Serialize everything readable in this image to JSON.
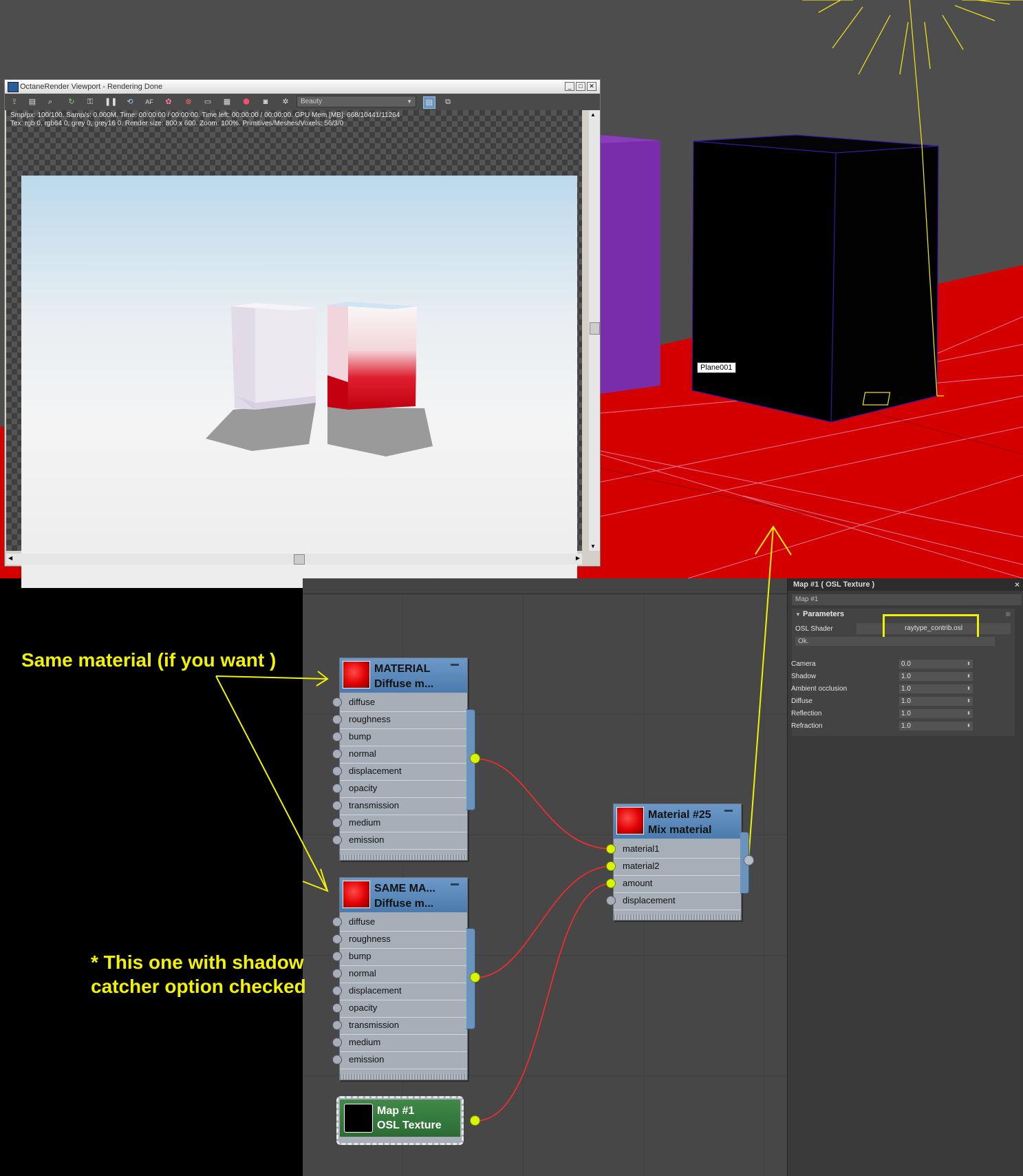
{
  "viewport": {
    "title": "OctaneRender Viewport - Rendering Done",
    "stats_line1": "Smp/px: 100/100.   Samp/s: 0.000M.   Time: 00:00:00 / 00:00:00.   Time left: 00:00:00 / 00:00:00.   GPU Mem [MB]: 668/10441/11264",
    "stats_line2": "Tex: rgb 0, rgb64 0, grey 0, grey16 0.   Render size: 800 x 600.   Zoom: 100%.   Primitives/Meshes/Voxels: 56/3/0",
    "pass_select": "Beauty",
    "buttons": [
      "minimize",
      "maximize",
      "close"
    ]
  },
  "scene": {
    "object_label": "Plane001",
    "floor_color": "#d40000",
    "box_color": "#7a2dab"
  },
  "annotations": {
    "same_material": "Same material (if you want )",
    "shadow_line1": "* This one with shadow",
    "shadow_line2": "catcher option checked"
  },
  "nodes": {
    "material1": {
      "title": "MATERIAL",
      "subtitle": "Diffuse m...",
      "ports": [
        "diffuse",
        "roughness",
        "bump",
        "normal",
        "displacement",
        "opacity",
        "transmission",
        "medium",
        "emission"
      ]
    },
    "material2": {
      "title": "SAME MA...",
      "subtitle": "Diffuse m...",
      "ports": [
        "diffuse",
        "roughness",
        "bump",
        "normal",
        "displacement",
        "opacity",
        "transmission",
        "medium",
        "emission"
      ]
    },
    "mix": {
      "title": "Material #25",
      "subtitle": "Mix material",
      "ports": [
        "material1",
        "material2",
        "amount",
        "displacement"
      ]
    },
    "map": {
      "title": "Map #1",
      "subtitle": "OSL Texture"
    }
  },
  "panel": {
    "header": "Map #1  ( OSL Texture )",
    "map_name": "Map #1",
    "group": "Parameters",
    "osl_label": "OSL Shader",
    "osl_file": "raytype_contrib.osl",
    "status": "Ok.",
    "params": [
      {
        "label": "Camera",
        "value": "0.0"
      },
      {
        "label": "Shadow",
        "value": "1.0"
      },
      {
        "label": "Ambient occlusion",
        "value": "1.0"
      },
      {
        "label": "Diffuse",
        "value": "1.0"
      },
      {
        "label": "Reflection",
        "value": "1.0"
      },
      {
        "label": "Refraction",
        "value": "1.0"
      }
    ]
  },
  "colors": {
    "annotation": "#f2f200",
    "wire": "#ff2a2a",
    "port_active": "#d7f500",
    "node_header": "#5686b9",
    "map_header": "#347a3d"
  }
}
